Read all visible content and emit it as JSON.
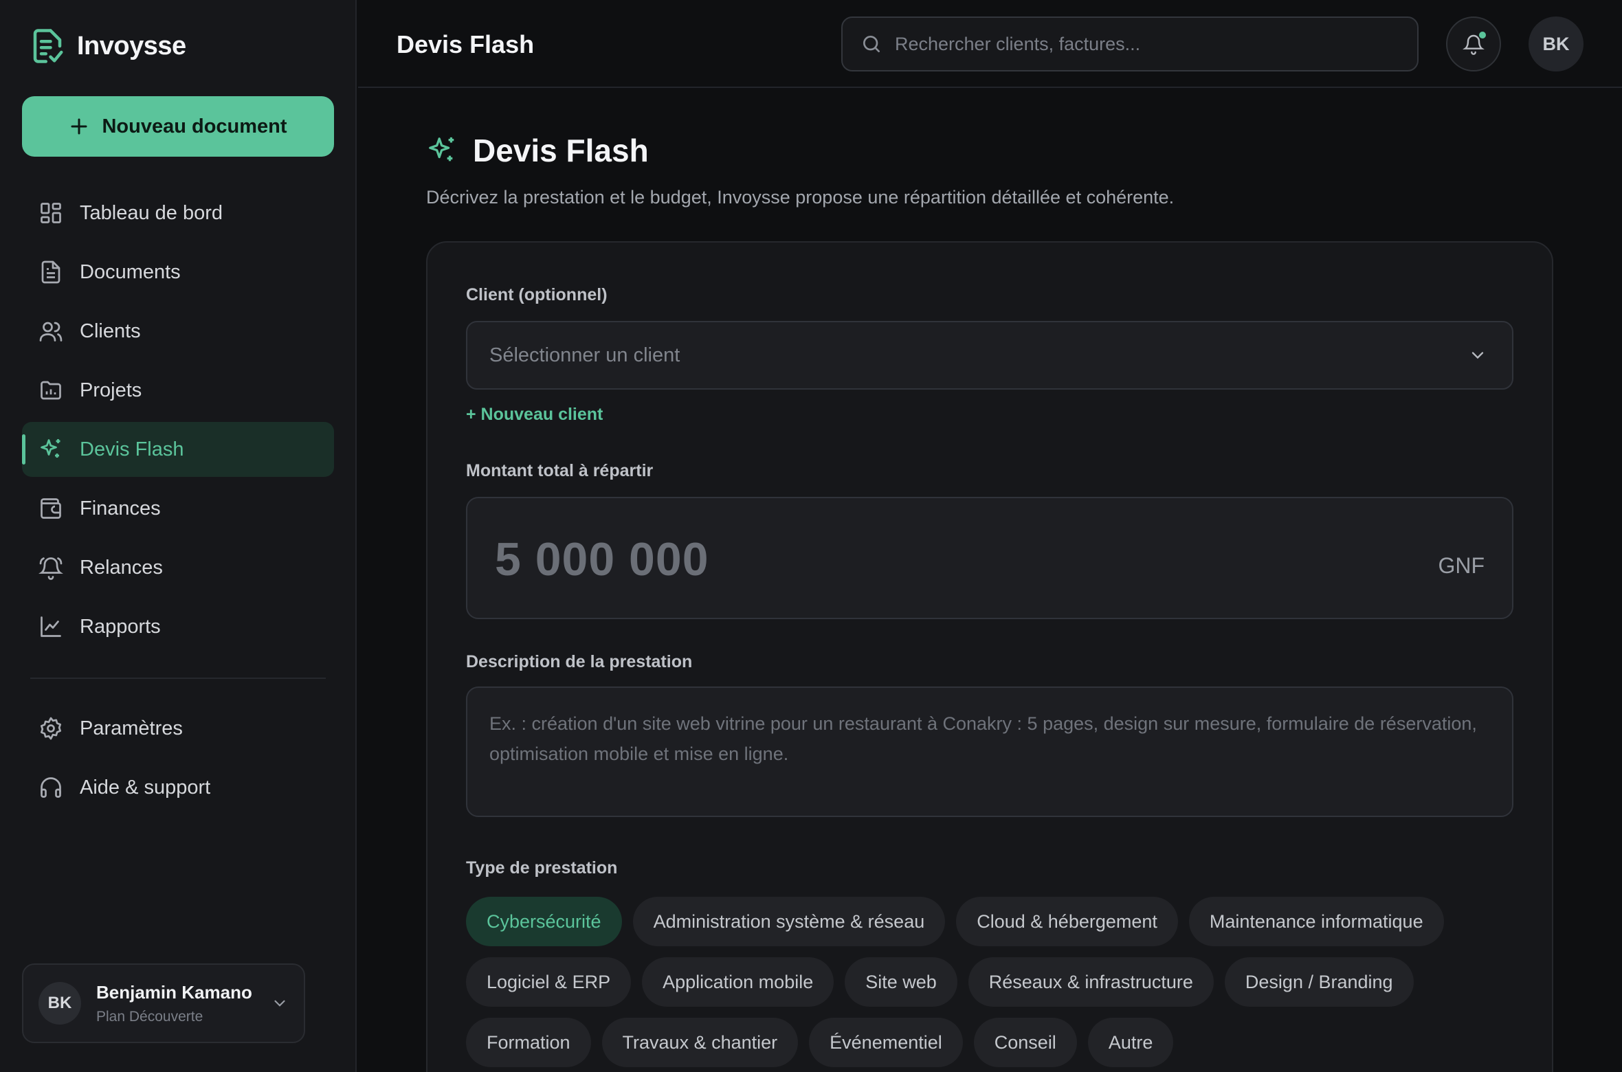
{
  "app": {
    "name": "Invoysse"
  },
  "sidebar": {
    "new_button": "Nouveau document",
    "items": [
      {
        "label": "Tableau de bord",
        "icon": "dashboard-icon"
      },
      {
        "label": "Documents",
        "icon": "document-icon"
      },
      {
        "label": "Clients",
        "icon": "users-icon"
      },
      {
        "label": "Projets",
        "icon": "folder-icon"
      },
      {
        "label": "Devis Flash",
        "icon": "sparkles-icon",
        "active": true
      },
      {
        "label": "Finances",
        "icon": "wallet-icon"
      },
      {
        "label": "Relances",
        "icon": "bell-ring-icon"
      },
      {
        "label": "Rapports",
        "icon": "chart-line-icon"
      }
    ],
    "secondary": [
      {
        "label": "Paramètres",
        "icon": "gear-icon"
      },
      {
        "label": "Aide & support",
        "icon": "headset-icon"
      }
    ],
    "user": {
      "initials": "BK",
      "name": "Benjamin Kamano",
      "plan": "Plan Découverte"
    }
  },
  "topbar": {
    "title": "Devis Flash",
    "search_placeholder": "Rechercher clients, factures...",
    "avatar": "BK"
  },
  "main": {
    "title": "Devis Flash",
    "subtitle": "Décrivez la prestation et le budget, Invoysse propose une répartition détaillée et cohérente.",
    "client": {
      "label": "Client (optionnel)",
      "placeholder": "Sélectionner un client",
      "new_link": "+ Nouveau client"
    },
    "amount": {
      "label": "Montant total à répartir",
      "placeholder": "5 000 000",
      "currency": "GNF"
    },
    "description": {
      "label": "Description de la prestation",
      "placeholder": "Ex. : création d'un site web vitrine pour un restaurant à Conakry : 5 pages, design sur mesure, formulaire de réservation, optimisation mobile et mise en ligne."
    },
    "type": {
      "label": "Type de prestation",
      "rows": [
        [
          "Cybersécurité",
          "Administration système & réseau",
          "Cloud & hébergement",
          "Maintenance informatique"
        ],
        [
          "Logiciel & ERP",
          "Application mobile",
          "Site web",
          "Réseaux & infrastructure",
          "Design / Branding"
        ],
        [
          "Formation",
          "Travaux & chantier",
          "Événementiel",
          "Conseil",
          "Autre"
        ]
      ],
      "selected": "Cybersécurité"
    }
  },
  "colors": {
    "accent": "#5bc49b",
    "background": "#0e0f11",
    "sidebar": "#16171a"
  }
}
